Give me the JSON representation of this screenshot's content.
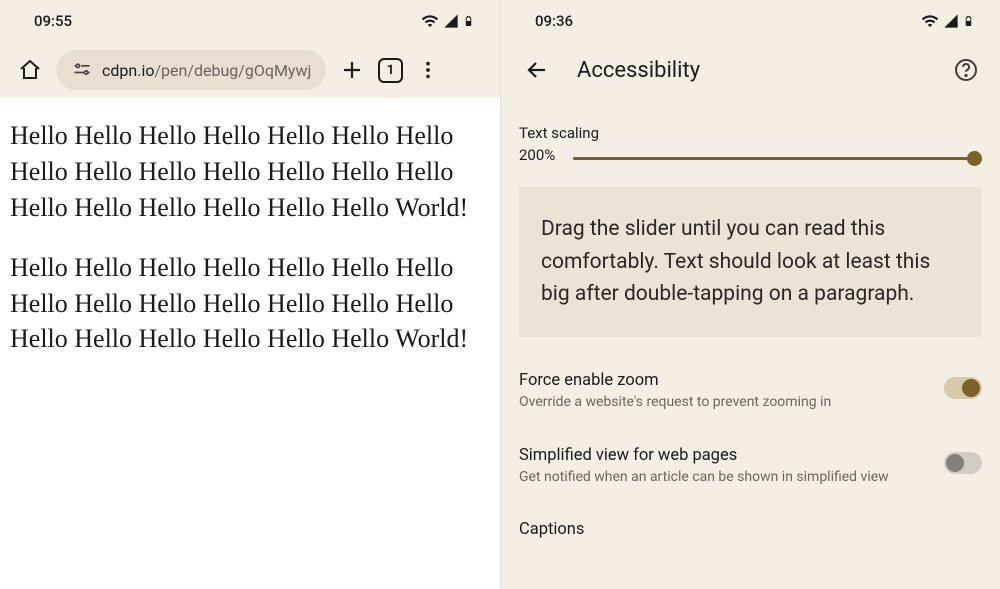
{
  "left": {
    "status": {
      "time": "09:55"
    },
    "browser": {
      "tabs_count": "1",
      "url_domain": "cdpn.io",
      "url_path": "/pen/debug/gOqMywj"
    },
    "page": {
      "p1": "Hello Hello Hello Hello Hello Hello Hello Hello Hello Hello Hello Hello Hello Hello Hello Hello Hello Hello Hello Hello World!",
      "p2": "Hello Hello Hello Hello Hello Hello Hello Hello Hello Hello Hello Hello Hello Hello Hello Hello Hello Hello Hello Hello World!"
    }
  },
  "right": {
    "status": {
      "time": "09:36"
    },
    "header": {
      "title": "Accessibility"
    },
    "text_scaling": {
      "label": "Text scaling",
      "value": "200%",
      "preview": "Drag the slider until you can read this comfortably. Text should look at least this big after double-tapping on a paragraph."
    },
    "force_zoom": {
      "title": "Force enable zoom",
      "subtitle": "Override a website's request to prevent zooming in"
    },
    "simplified": {
      "title": "Simplified view for web pages",
      "subtitle": "Get notified when an article can be shown in simplified view"
    },
    "captions": {
      "title": "Captions"
    }
  }
}
